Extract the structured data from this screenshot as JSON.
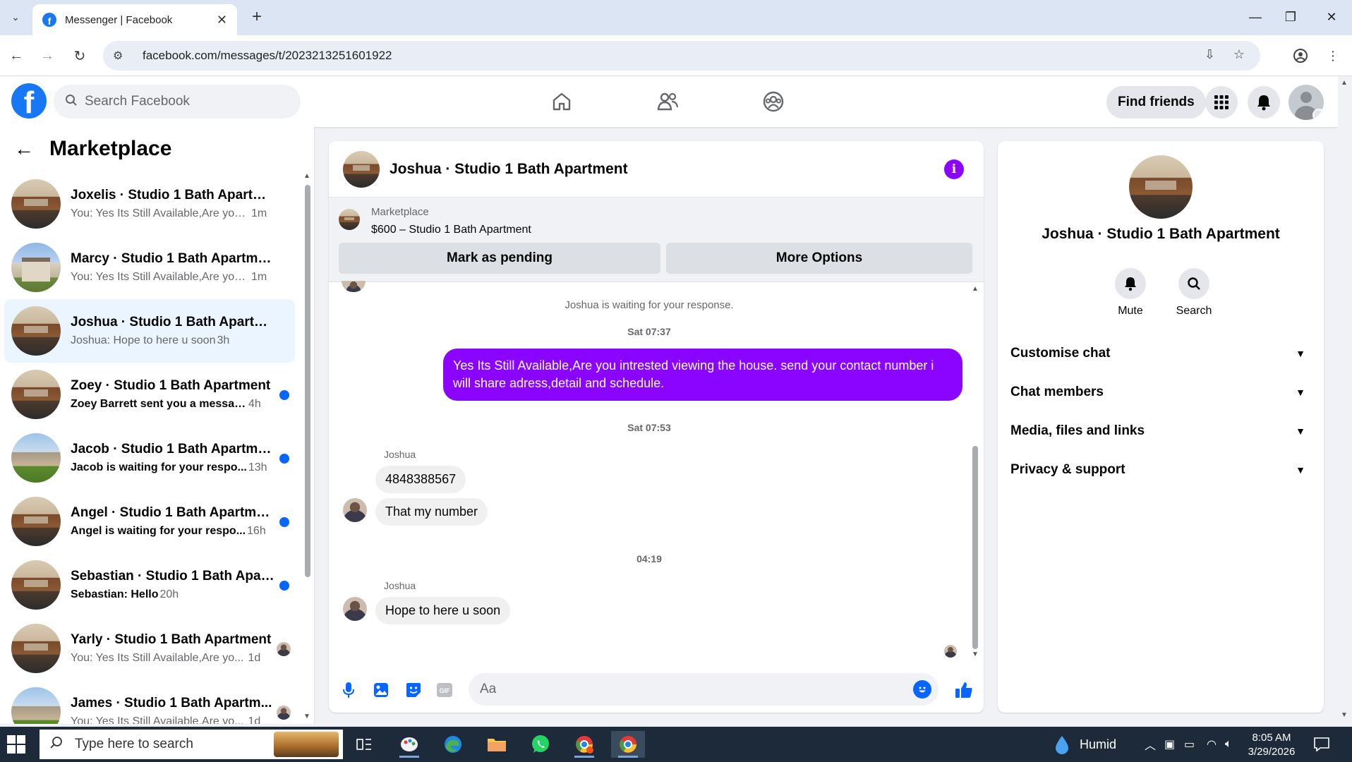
{
  "browser": {
    "tab_title": "Messenger | Facebook",
    "url": "facebook.com/messages/t/2023213251601922"
  },
  "header": {
    "search_placeholder": "Search Facebook",
    "find_friends": "Find friends"
  },
  "sidebar": {
    "title": "Marketplace",
    "conversations": [
      {
        "name": "Joxelis · Studio 1 Bath Apartment",
        "preview": "You: Yes Its Still Available,Are you i...",
        "time": "1m",
        "thumb": "kitchen",
        "unread": false
      },
      {
        "name": "Marcy · Studio 1 Bath Apartment",
        "preview": "You: Yes Its Still Available,Are you i...",
        "time": "1m",
        "thumb": "house",
        "unread": false
      },
      {
        "name": "Joshua · Studio 1 Bath Apartment",
        "preview": "Joshua: Hope to here u soon",
        "time": "3h",
        "thumb": "kitchen",
        "unread": false,
        "active": true
      },
      {
        "name": "Zoey · Studio 1 Bath Apartment",
        "preview": "Zoey Barrett sent you a messag...",
        "time": "4h",
        "thumb": "kitchen",
        "unread": true
      },
      {
        "name": "Jacob · Studio 1 Bath Apartment",
        "preview": "Jacob is waiting for your respo...",
        "time": "13h",
        "thumb": "house2",
        "unread": true
      },
      {
        "name": "Angel · Studio 1 Bath Apartment",
        "preview": "Angel is waiting for your respo...",
        "time": "16h",
        "thumb": "kitchen",
        "unread": true
      },
      {
        "name": "Sebastian · Studio 1 Bath Apart...",
        "preview": "Sebastian: Hello",
        "time": "20h",
        "thumb": "kitchen",
        "unread": true
      },
      {
        "name": "Yarly · Studio 1 Bath Apartment",
        "preview": "You: Yes Its Still Available,Are yo...",
        "time": "1d",
        "thumb": "kitchen",
        "unread": false
      },
      {
        "name": "James · Studio 1 Bath Apartm...",
        "preview": "You: Yes Its Still Available,Are yo...",
        "time": "1d",
        "thumb": "house2",
        "unread": false
      }
    ]
  },
  "chat": {
    "title": "Joshua · Studio 1 Bath Apartment",
    "marketplace_label": "Marketplace",
    "listing": "$600 – Studio 1 Bath Apartment",
    "mark_pending": "Mark as pending",
    "more_options": "More Options",
    "waiting_notice": "Joshua is waiting for your response.",
    "stamp1": "Sat 07:37",
    "outgoing": "Yes Its Still Available,Are you intrested viewing the house. send your contact number i will share adress,detail and schedule.",
    "stamp2": "Sat 07:53",
    "sender": "Joshua",
    "msg_number": "4848388567",
    "msg_thatnumber": "That my number",
    "stamp3": "04:19",
    "msg_hope": "Hope to here u soon",
    "input_placeholder": "Aa"
  },
  "info": {
    "name": "Joshua · Studio 1 Bath Apartment",
    "mute": "Mute",
    "search": "Search",
    "sections": [
      "Customise chat",
      "Chat members",
      "Media, files and links",
      "Privacy & support"
    ]
  },
  "taskbar": {
    "search_placeholder": "Type here to search",
    "weather": "Humid",
    "time": "8:05 AM",
    "date": "3/29/2026"
  },
  "colors": {
    "brand": "#1877f2",
    "accent_purple": "#8a04ff",
    "unread_dot": "#0866ff"
  }
}
